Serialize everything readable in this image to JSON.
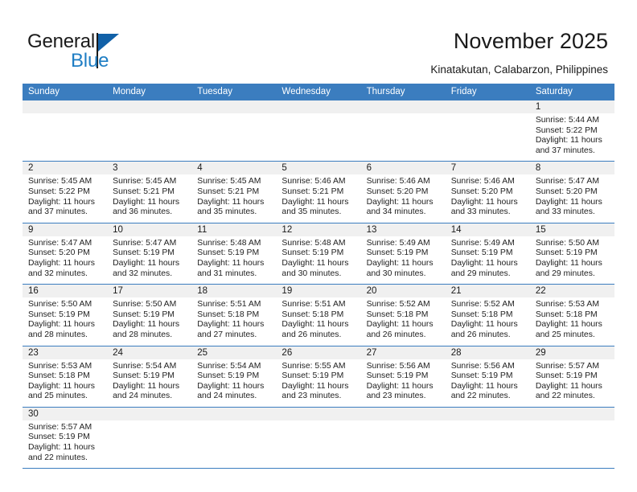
{
  "brand": {
    "name_part1": "General",
    "name_part2": "Blue",
    "logo_icon": "blue-triangle-flag-icon"
  },
  "header": {
    "title": "November 2025",
    "subtitle": "Kinatakutan, Calabarzon, Philippines"
  },
  "colors": {
    "header_blue": "#3b7dbf",
    "brand_blue": "#1f7ec4",
    "daynum_band": "#f0f0f0",
    "text": "#1a1a1a"
  },
  "weekdays": [
    "Sunday",
    "Monday",
    "Tuesday",
    "Wednesday",
    "Thursday",
    "Friday",
    "Saturday"
  ],
  "weeks": [
    [
      {
        "day": "",
        "lines": []
      },
      {
        "day": "",
        "lines": []
      },
      {
        "day": "",
        "lines": []
      },
      {
        "day": "",
        "lines": []
      },
      {
        "day": "",
        "lines": []
      },
      {
        "day": "",
        "lines": []
      },
      {
        "day": "1",
        "lines": [
          "Sunrise: 5:44 AM",
          "Sunset: 5:22 PM",
          "Daylight: 11 hours",
          "and 37 minutes."
        ]
      }
    ],
    [
      {
        "day": "2",
        "lines": [
          "Sunrise: 5:45 AM",
          "Sunset: 5:22 PM",
          "Daylight: 11 hours",
          "and 37 minutes."
        ]
      },
      {
        "day": "3",
        "lines": [
          "Sunrise: 5:45 AM",
          "Sunset: 5:21 PM",
          "Daylight: 11 hours",
          "and 36 minutes."
        ]
      },
      {
        "day": "4",
        "lines": [
          "Sunrise: 5:45 AM",
          "Sunset: 5:21 PM",
          "Daylight: 11 hours",
          "and 35 minutes."
        ]
      },
      {
        "day": "5",
        "lines": [
          "Sunrise: 5:46 AM",
          "Sunset: 5:21 PM",
          "Daylight: 11 hours",
          "and 35 minutes."
        ]
      },
      {
        "day": "6",
        "lines": [
          "Sunrise: 5:46 AM",
          "Sunset: 5:20 PM",
          "Daylight: 11 hours",
          "and 34 minutes."
        ]
      },
      {
        "day": "7",
        "lines": [
          "Sunrise: 5:46 AM",
          "Sunset: 5:20 PM",
          "Daylight: 11 hours",
          "and 33 minutes."
        ]
      },
      {
        "day": "8",
        "lines": [
          "Sunrise: 5:47 AM",
          "Sunset: 5:20 PM",
          "Daylight: 11 hours",
          "and 33 minutes."
        ]
      }
    ],
    [
      {
        "day": "9",
        "lines": [
          "Sunrise: 5:47 AM",
          "Sunset: 5:20 PM",
          "Daylight: 11 hours",
          "and 32 minutes."
        ]
      },
      {
        "day": "10",
        "lines": [
          "Sunrise: 5:47 AM",
          "Sunset: 5:19 PM",
          "Daylight: 11 hours",
          "and 32 minutes."
        ]
      },
      {
        "day": "11",
        "lines": [
          "Sunrise: 5:48 AM",
          "Sunset: 5:19 PM",
          "Daylight: 11 hours",
          "and 31 minutes."
        ]
      },
      {
        "day": "12",
        "lines": [
          "Sunrise: 5:48 AM",
          "Sunset: 5:19 PM",
          "Daylight: 11 hours",
          "and 30 minutes."
        ]
      },
      {
        "day": "13",
        "lines": [
          "Sunrise: 5:49 AM",
          "Sunset: 5:19 PM",
          "Daylight: 11 hours",
          "and 30 minutes."
        ]
      },
      {
        "day": "14",
        "lines": [
          "Sunrise: 5:49 AM",
          "Sunset: 5:19 PM",
          "Daylight: 11 hours",
          "and 29 minutes."
        ]
      },
      {
        "day": "15",
        "lines": [
          "Sunrise: 5:50 AM",
          "Sunset: 5:19 PM",
          "Daylight: 11 hours",
          "and 29 minutes."
        ]
      }
    ],
    [
      {
        "day": "16",
        "lines": [
          "Sunrise: 5:50 AM",
          "Sunset: 5:19 PM",
          "Daylight: 11 hours",
          "and 28 minutes."
        ]
      },
      {
        "day": "17",
        "lines": [
          "Sunrise: 5:50 AM",
          "Sunset: 5:19 PM",
          "Daylight: 11 hours",
          "and 28 minutes."
        ]
      },
      {
        "day": "18",
        "lines": [
          "Sunrise: 5:51 AM",
          "Sunset: 5:18 PM",
          "Daylight: 11 hours",
          "and 27 minutes."
        ]
      },
      {
        "day": "19",
        "lines": [
          "Sunrise: 5:51 AM",
          "Sunset: 5:18 PM",
          "Daylight: 11 hours",
          "and 26 minutes."
        ]
      },
      {
        "day": "20",
        "lines": [
          "Sunrise: 5:52 AM",
          "Sunset: 5:18 PM",
          "Daylight: 11 hours",
          "and 26 minutes."
        ]
      },
      {
        "day": "21",
        "lines": [
          "Sunrise: 5:52 AM",
          "Sunset: 5:18 PM",
          "Daylight: 11 hours",
          "and 26 minutes."
        ]
      },
      {
        "day": "22",
        "lines": [
          "Sunrise: 5:53 AM",
          "Sunset: 5:18 PM",
          "Daylight: 11 hours",
          "and 25 minutes."
        ]
      }
    ],
    [
      {
        "day": "23",
        "lines": [
          "Sunrise: 5:53 AM",
          "Sunset: 5:18 PM",
          "Daylight: 11 hours",
          "and 25 minutes."
        ]
      },
      {
        "day": "24",
        "lines": [
          "Sunrise: 5:54 AM",
          "Sunset: 5:19 PM",
          "Daylight: 11 hours",
          "and 24 minutes."
        ]
      },
      {
        "day": "25",
        "lines": [
          "Sunrise: 5:54 AM",
          "Sunset: 5:19 PM",
          "Daylight: 11 hours",
          "and 24 minutes."
        ]
      },
      {
        "day": "26",
        "lines": [
          "Sunrise: 5:55 AM",
          "Sunset: 5:19 PM",
          "Daylight: 11 hours",
          "and 23 minutes."
        ]
      },
      {
        "day": "27",
        "lines": [
          "Sunrise: 5:56 AM",
          "Sunset: 5:19 PM",
          "Daylight: 11 hours",
          "and 23 minutes."
        ]
      },
      {
        "day": "28",
        "lines": [
          "Sunrise: 5:56 AM",
          "Sunset: 5:19 PM",
          "Daylight: 11 hours",
          "and 22 minutes."
        ]
      },
      {
        "day": "29",
        "lines": [
          "Sunrise: 5:57 AM",
          "Sunset: 5:19 PM",
          "Daylight: 11 hours",
          "and 22 minutes."
        ]
      }
    ],
    [
      {
        "day": "30",
        "lines": [
          "Sunrise: 5:57 AM",
          "Sunset: 5:19 PM",
          "Daylight: 11 hours",
          "and 22 minutes."
        ]
      },
      {
        "day": "",
        "lines": []
      },
      {
        "day": "",
        "lines": []
      },
      {
        "day": "",
        "lines": []
      },
      {
        "day": "",
        "lines": []
      },
      {
        "day": "",
        "lines": []
      },
      {
        "day": "",
        "lines": []
      }
    ]
  ]
}
